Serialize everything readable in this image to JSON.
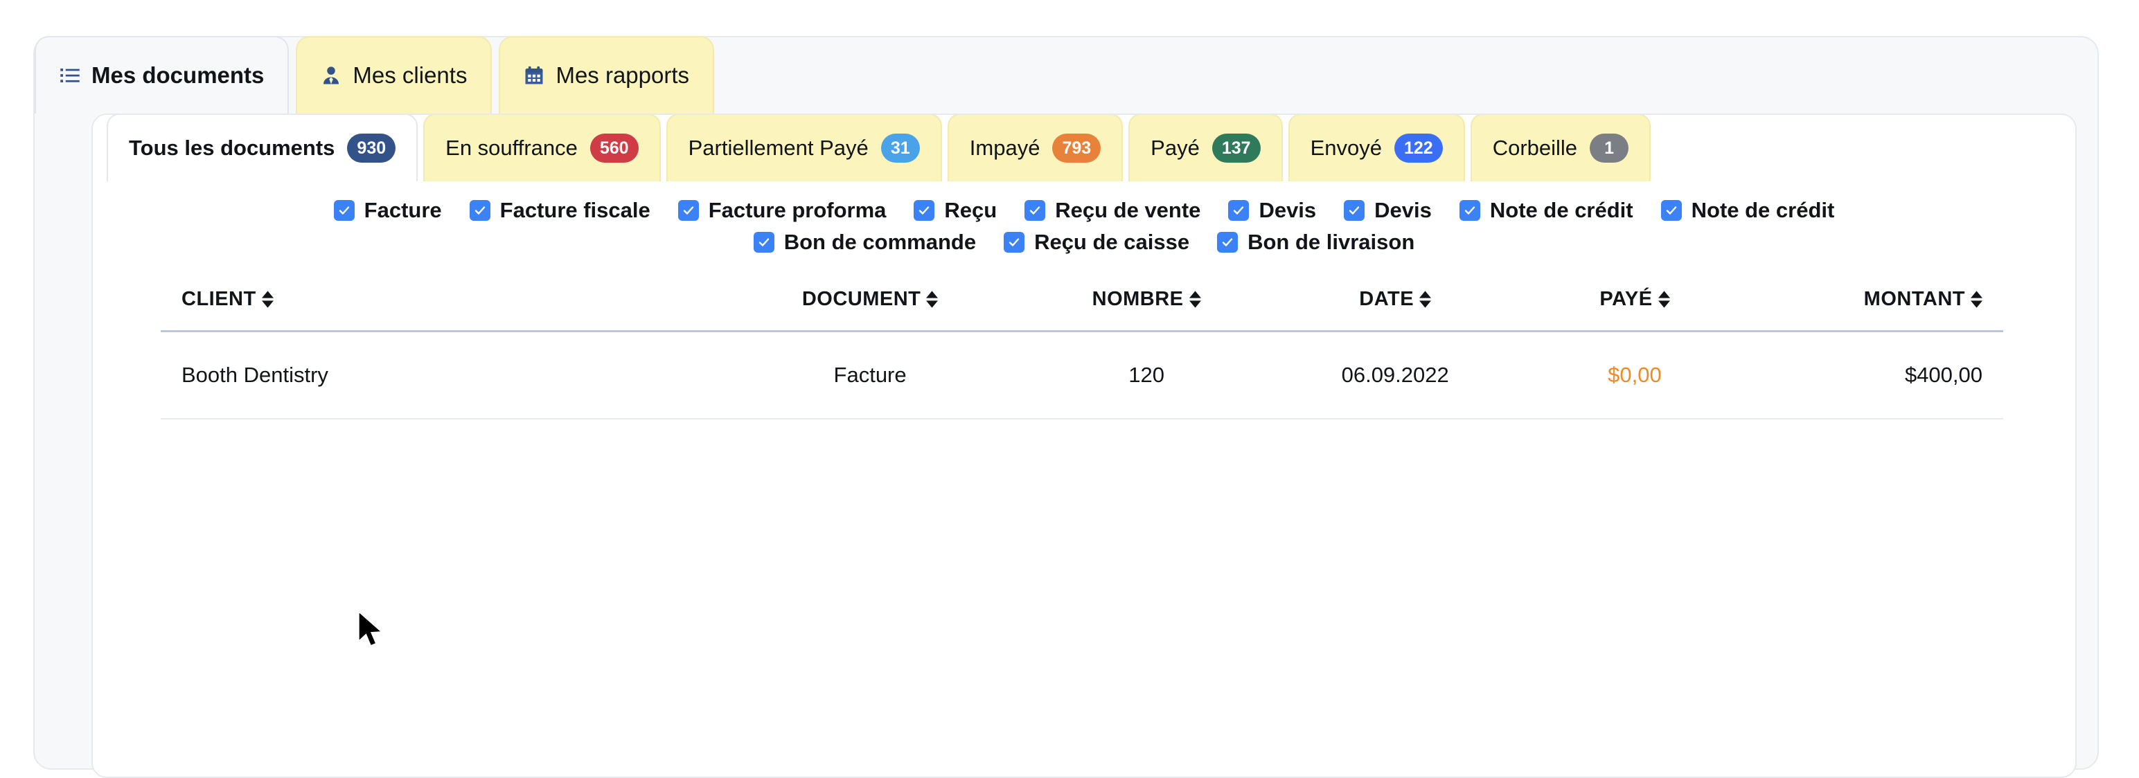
{
  "main_tabs": [
    {
      "label": "Mes documents",
      "icon": "list-icon",
      "active": true
    },
    {
      "label": "Mes clients",
      "icon": "user-icon",
      "active": false
    },
    {
      "label": "Mes rapports",
      "icon": "calendar-icon",
      "active": false
    }
  ],
  "sub_tabs": [
    {
      "label": "Tous les documents",
      "count": "930",
      "badge_color": "#34528a",
      "active": true
    },
    {
      "label": "En souffrance",
      "count": "560",
      "badge_color": "#cf3c46",
      "active": false
    },
    {
      "label": "Partiellement Payé",
      "count": "31",
      "badge_color": "#4aa3e8",
      "active": false
    },
    {
      "label": "Impayé",
      "count": "793",
      "badge_color": "#e8813a",
      "active": false
    },
    {
      "label": "Payé",
      "count": "137",
      "badge_color": "#2f7a5a",
      "active": false
    },
    {
      "label": "Envoyé",
      "count": "122",
      "badge_color": "#3b6ef6",
      "active": false
    },
    {
      "label": "Corbeille",
      "count": "1",
      "badge_color": "#7b7f85",
      "active": false
    }
  ],
  "filters": {
    "row1": [
      {
        "label": "Facture",
        "checked": true
      },
      {
        "label": "Facture fiscale",
        "checked": true
      },
      {
        "label": "Facture proforma",
        "checked": true
      },
      {
        "label": "Reçu",
        "checked": true
      },
      {
        "label": "Reçu de vente",
        "checked": true
      },
      {
        "label": "Devis",
        "checked": true
      },
      {
        "label": "Devis",
        "checked": true
      },
      {
        "label": "Note de crédit",
        "checked": true
      },
      {
        "label": "Note de crédit",
        "checked": true
      }
    ],
    "row2": [
      {
        "label": "Bon de commande",
        "checked": true
      },
      {
        "label": "Reçu de caisse",
        "checked": true
      },
      {
        "label": "Bon de livraison",
        "checked": true
      }
    ]
  },
  "table": {
    "columns": [
      {
        "label": "CLIENT",
        "sortable": true
      },
      {
        "label": "DOCUMENT",
        "sortable": true
      },
      {
        "label": "NOMBRE",
        "sortable": true
      },
      {
        "label": "DATE",
        "sortable": true
      },
      {
        "label": "PAYÉ",
        "sortable": true
      },
      {
        "label": "MONTANT",
        "sortable": true
      }
    ],
    "rows": [
      {
        "client": "Booth Dentistry",
        "document": "Facture",
        "nombre": "120",
        "date": "06.09.2022",
        "paye": "$0,00",
        "montant": "$400,00"
      }
    ]
  },
  "colors": {
    "accent_navy": "#34528a",
    "tab_yellow": "#fbf5bd",
    "checkbox_blue": "#3b82f6",
    "paye_orange": "#f08a24",
    "panel_bg": "#f6f8fa"
  },
  "cursor": {
    "visible": true
  }
}
